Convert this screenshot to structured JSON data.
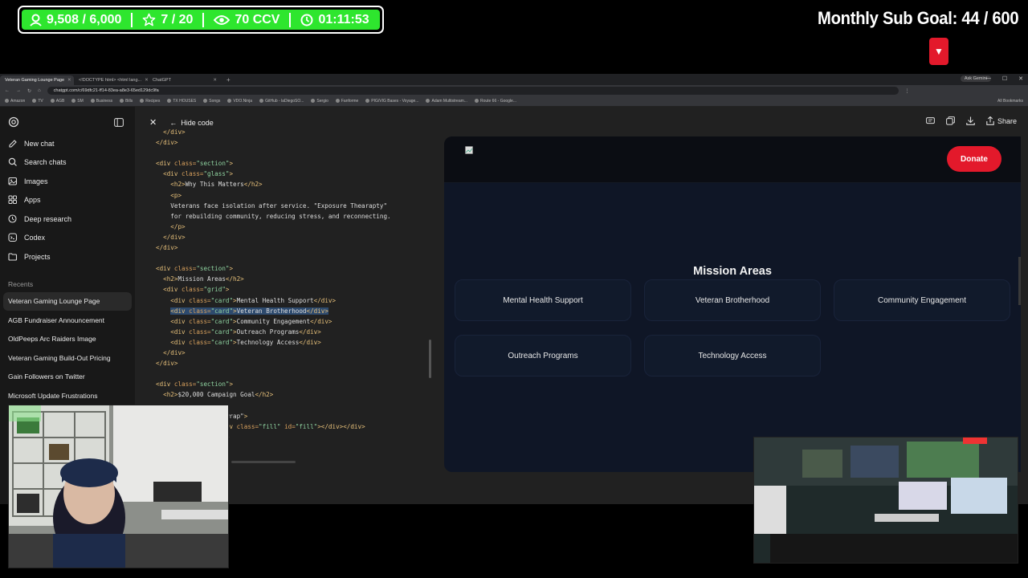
{
  "overlay": {
    "stats": {
      "followers": "9,508 / 6,000",
      "rating": "7 / 20",
      "ccv": "70 CCV",
      "timer": "01:11:53"
    },
    "sub_goal": "Monthly Sub Goal:  44 / 600",
    "colors": {
      "stats_bg": "#2ee62e",
      "marker": "#e3192b"
    }
  },
  "browser": {
    "tabs": [
      {
        "label": "Veteran Gaming Lounge Page",
        "active": true
      },
      {
        "label": "<!DOCTYPE html> <html lang...",
        "active": false
      },
      {
        "label": "ChatGPT",
        "active": false
      }
    ],
    "ask_gemini": "Ask Gemini",
    "url": "chatgpt.com/c/69dfc21-ff14-83ea-a8e3-65ed129dc9fa",
    "bookmarks": [
      "Amazon",
      "TV",
      "AGB",
      "SM",
      "Business",
      "Bills",
      "Recipes",
      "TX HOUSES",
      "Songs",
      "VDO.Ninja",
      "GitHub - laDiegoSO...",
      "Sergio",
      "Fanforme",
      "PIG/VIG Bases - Voyage...",
      "Adam Multistream...",
      "Route 66 - Google..."
    ],
    "all_bookmarks": "All Bookmarks"
  },
  "sidebar": {
    "items": [
      {
        "label": "New chat",
        "icon": "edit-icon"
      },
      {
        "label": "Search chats",
        "icon": "search-icon"
      },
      {
        "label": "Images",
        "icon": "image-icon"
      },
      {
        "label": "Apps",
        "icon": "apps-icon"
      },
      {
        "label": "Deep research",
        "icon": "research-icon"
      },
      {
        "label": "Codex",
        "icon": "codex-icon"
      },
      {
        "label": "Projects",
        "icon": "folder-icon"
      }
    ],
    "recents_label": "Recents",
    "recents": [
      "Veteran Gaming Lounge Page",
      "AGB Fundraiser Announcement",
      "OldPeeps Arc Raiders Image",
      "Veteran Gaming Build-Out Pricing",
      "Gain Followers on Twitter",
      "Microsoft Update Frustrations"
    ]
  },
  "code_panel": {
    "hide_code": "Hide code"
  },
  "preview": {
    "toolbar": {
      "share": "Share"
    },
    "donate": "Donate",
    "mission_title": "Mission Areas",
    "cards": [
      "Mental Health Support",
      "Veteran Brotherhood",
      "Community Engagement",
      "Outreach Programs",
      "Technology Access"
    ]
  }
}
